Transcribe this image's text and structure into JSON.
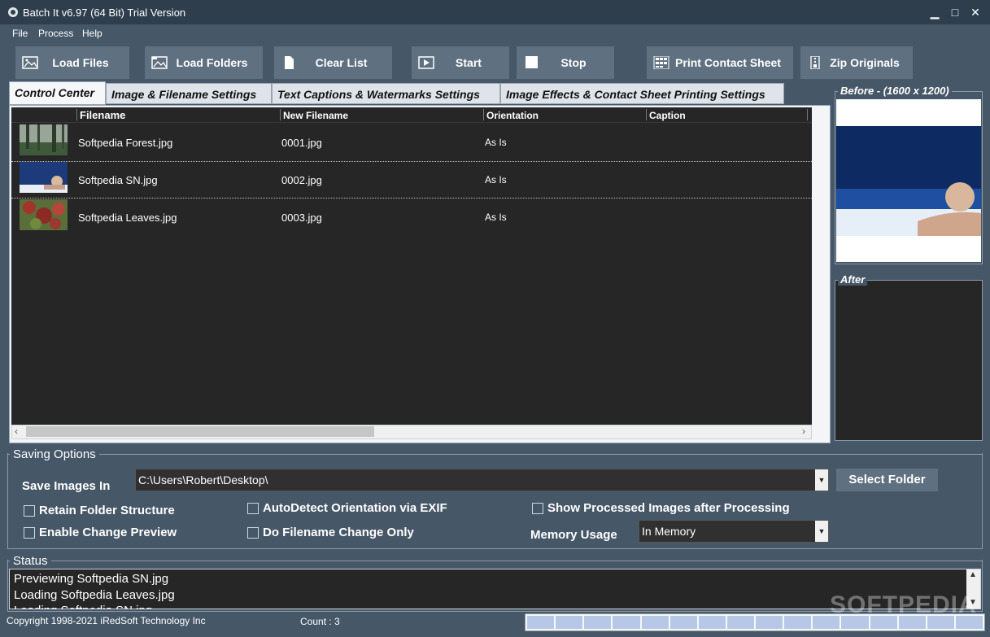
{
  "window": {
    "title": "Batch It v6.97 (64 Bit) Trial Version",
    "controls": {
      "minimize": "▁",
      "maximize": "□",
      "close": "✕"
    }
  },
  "menu": {
    "items": [
      "File",
      "Process",
      "Help"
    ]
  },
  "toolbar": {
    "load_files": "Load Files",
    "load_folders": "Load Folders",
    "clear_list": "Clear List",
    "start": "Start",
    "stop": "Stop",
    "print_contact_sheet": "Print Contact Sheet",
    "zip_originals": "Zip Originals"
  },
  "tabs": [
    "Control Center",
    "Image & Filename Settings",
    "Text Captions & Watermarks Settings",
    "Image Effects & Contact Sheet Printing Settings"
  ],
  "grid": {
    "columns": [
      "Filename",
      "New Filename",
      "Orientation",
      "Caption"
    ],
    "rows": [
      {
        "filename": "Softpedia Forest.jpg",
        "new_filename": "0001.jpg",
        "orientation": "As Is"
      },
      {
        "filename": "Softpedia SN.jpg",
        "new_filename": "0002.jpg",
        "orientation": "As Is"
      },
      {
        "filename": "Softpedia Leaves.jpg",
        "new_filename": "0003.jpg",
        "orientation": "As Is"
      }
    ]
  },
  "preview": {
    "before_title": "Before - (1600 x 1200)",
    "after_title": "After"
  },
  "saving": {
    "title": "Saving Options",
    "save_in_label": "Save Images In",
    "save_in_value": "C:\\Users\\Robert\\Desktop\\",
    "select_folder": "Select Folder",
    "retain_folder": "Retain Folder Structure",
    "enable_preview": "Enable Change Preview",
    "autodetect": "AutoDetect Orientation via EXIF",
    "filename_only": "Do Filename Change Only",
    "show_processed": "Show Processed Images after Processing",
    "memory_label": "Memory Usage",
    "memory_value": "In Memory"
  },
  "status": {
    "title": "Status",
    "lines": [
      "Previewing Softpedia SN.jpg",
      "Loading Softpedia Leaves.jpg",
      "Loading Softpedia SN.jpg"
    ]
  },
  "footer": {
    "copyright": "Copyright 1998-2021 iRedSoft Technology Inc",
    "count": "Count : 3"
  },
  "watermark": "SOFTPEDIA",
  "colors": {
    "accent": "#5f7080",
    "background": "#465768",
    "grid": "#262626"
  }
}
